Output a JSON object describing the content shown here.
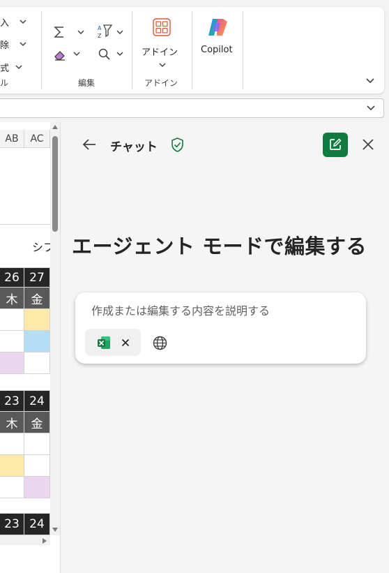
{
  "ribbon": {
    "cells_group": {
      "insert_label": "入",
      "delete_label": "除",
      "format_label": "式",
      "group_label": "ル"
    },
    "editing_group": {
      "group_label": "編集",
      "autosum_icon": "sigma-icon",
      "sort_filter_icon": "sort-filter-icon",
      "clear_icon": "eraser-icon",
      "find_icon": "search-icon"
    },
    "addins_group": {
      "button_label": "アドイン",
      "group_label": "アドイン",
      "icon": "addins-grid-icon"
    },
    "copilot": {
      "button_label": "Copilot",
      "icon": "copilot-logo"
    }
  },
  "sheet": {
    "columns": [
      "AB",
      "AC"
    ],
    "shift_label": "シフ",
    "block1": {
      "day_numbers": [
        "26",
        "27"
      ],
      "weekdays": [
        "木",
        "金"
      ]
    },
    "block2": {
      "day_numbers": [
        "23",
        "24"
      ],
      "weekdays": [
        "木",
        "金"
      ]
    },
    "block3": {
      "day_numbers": [
        "23",
        "24"
      ]
    },
    "colors": {
      "yellow": "#fde9a9",
      "blue": "#b4def5",
      "purple": "#ead7ef",
      "dark_header": "#262626",
      "grey_header": "#595959"
    }
  },
  "chat": {
    "title": "チャット",
    "back_icon": "arrow-left-icon",
    "shield_icon": "shield-check-icon",
    "new_chat_icon": "new-chat-icon",
    "close_icon": "close-icon",
    "accent_color": "#0f7b3f",
    "heading": "エージェント モードで編集する",
    "compose": {
      "placeholder": "作成または編集する内容を説明する",
      "attachment_icon": "excel-icon",
      "remove_icon": "close-icon",
      "web_icon": "globe-icon"
    }
  }
}
